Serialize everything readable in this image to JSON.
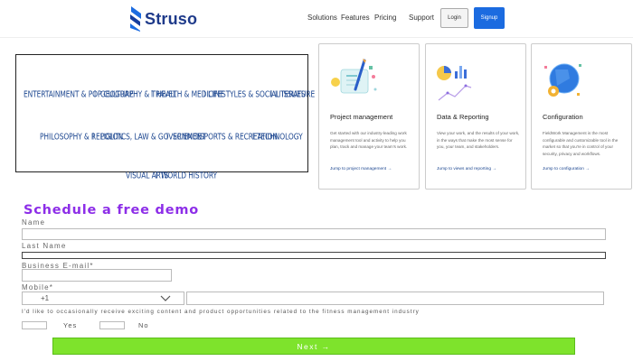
{
  "header": {
    "brand": "Struso",
    "nav": [
      "Solutions",
      "Features",
      "Pricing",
      "Support"
    ],
    "login_label": "Login",
    "signup_label": "Signup"
  },
  "topics": {
    "row1": [
      "ENTERTAINMENT & POP CULTURE",
      "GEOGRAPHY & TRAVEL",
      "HEALTH & MEDICINE",
      "LIFESTYLES & SOCIAL ISSUES",
      "LITERATURE"
    ],
    "row2": [
      "PHILOSOPHY & RELIGION",
      "POLITICS, LAW & GOVERNMENT",
      "SCIENCE",
      "SPORTS & RECREATION",
      "TECHNOLOGY"
    ],
    "row3": [
      "VISUAL ARTS",
      "WORLD HISTORY"
    ]
  },
  "cards": [
    {
      "title": "Project management",
      "desc": "Get started with our industry-leading work management tool and activity to help you plan, track and manage your team's work.",
      "link": "Jump to project management →",
      "icon": "project-management-illustration"
    },
    {
      "title": "Data & Reporting",
      "desc": "View your work, and the results of your work, in the ways that make the most sense for you, your team, and stakeholders.",
      "link": "Jump to views and reporting →",
      "icon": "data-reporting-illustration"
    },
    {
      "title": "Configuration",
      "desc": "FieldWork Management is the most configurable and customizable tool in the market so that you're in control of your security, privacy and workflows.",
      "link": "Jump to configuration →",
      "icon": "configuration-illustration"
    }
  ],
  "form": {
    "title": "Schedule a free demo",
    "name_label": "Name",
    "last_name_label": "Last Name",
    "email_label": "Business E-mail*",
    "mobile_label": "Mobile*",
    "country_code": "+1",
    "consent_text": "I'd like to occasionally receive exciting content and product opportunities related to the fitness management industry",
    "yes_label": "Yes",
    "no_label": "No",
    "next_label": "Next →"
  },
  "colors": {
    "brand": "#1e3a8a",
    "accent_blue": "#1b6be0",
    "form_title": "#8d2ee8",
    "next_button": "#7ee32c",
    "topic_text": "#1d4790"
  }
}
